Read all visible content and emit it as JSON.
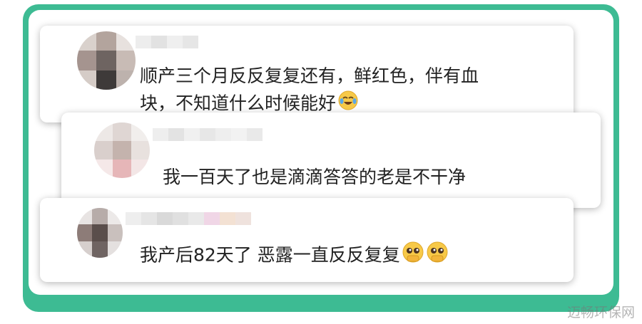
{
  "comments": [
    {
      "line1": "顺产三个月反反复复还有，鲜红色，伴有血",
      "line2": "块，不知道什么时候能好",
      "emoji": "crying-laughing-emoji-icon"
    },
    {
      "text": "我一百天了也是滴滴答答的老是不干净"
    },
    {
      "text": "我产后82天了 恶露一直反反复复",
      "emojis": [
        "pleading-face-emoji-icon",
        "pleading-face-emoji-icon"
      ]
    }
  ],
  "watermark": "迈畅环保网",
  "colors": {
    "frame": "#3dbb93",
    "card": "#ffffff",
    "text": "#222222"
  }
}
